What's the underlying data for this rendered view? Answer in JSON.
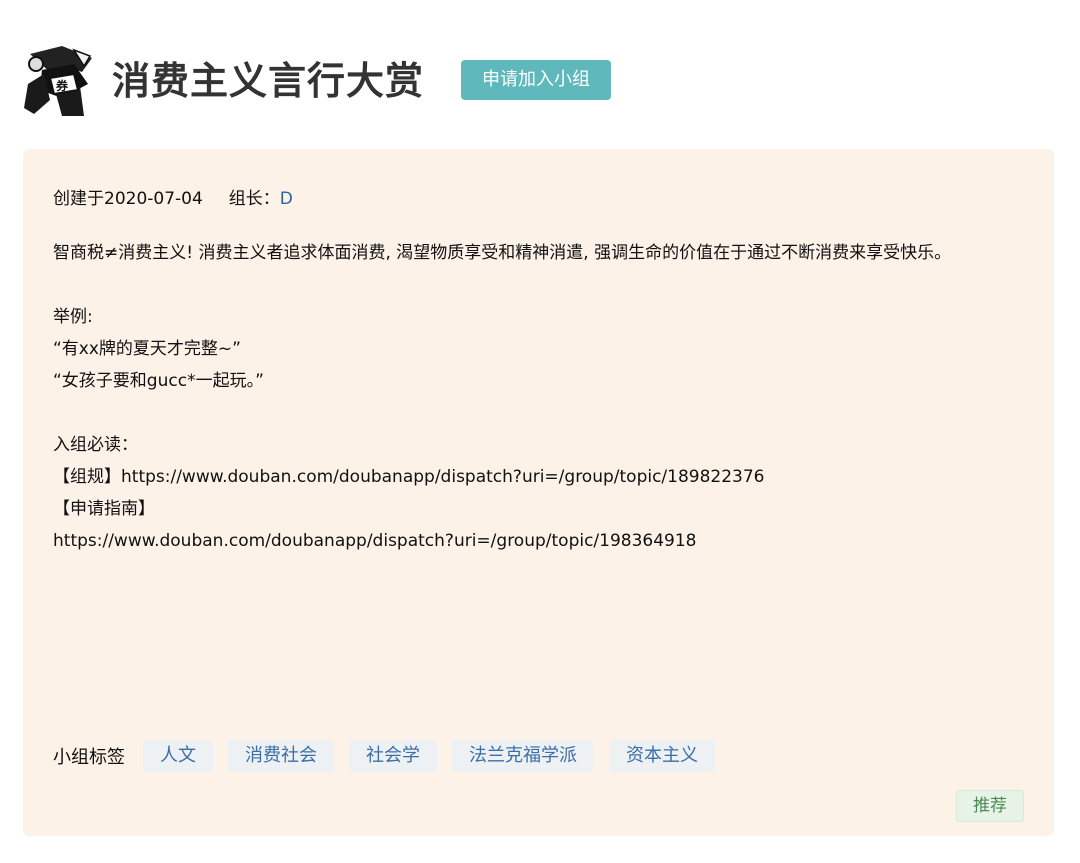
{
  "header": {
    "group_name": "消费主义言行大赏",
    "join_label": "申请加入小组",
    "logo_icon": "group-avatar-icon"
  },
  "info": {
    "created_text": "创建于2020-07-04",
    "owner_label": "组长：",
    "owner_name": "D",
    "description_lines": [
      "智商税≠消费主义! 消费主义者追求体面消费, 渴望物质享受和精神消遣, 强调生命的价值在于通过不断消费来享受快乐。",
      "",
      "举例:",
      "“有xx牌的夏天才完整~”",
      "“女孩子要和gucc*一起玩。”",
      "",
      "入组必读：",
      "【组规】https://www.douban.com/doubanapp/dispatch?uri=/group/topic/189822376",
      "【申请指南】",
      "https://www.douban.com/doubanapp/dispatch?uri=/group/topic/198364918"
    ]
  },
  "tags": {
    "label": "小组标签",
    "items": [
      "人文",
      "消费社会",
      "社会学",
      "法兰克福学派",
      "资本主义"
    ]
  },
  "recommend_label": "推荐",
  "colors": {
    "join_button": "#5fb9bc",
    "info_background": "#fdf2e8",
    "link": "#2e63a8",
    "tag_background": "#eef1f4",
    "recommend_text": "#4c8a56"
  }
}
